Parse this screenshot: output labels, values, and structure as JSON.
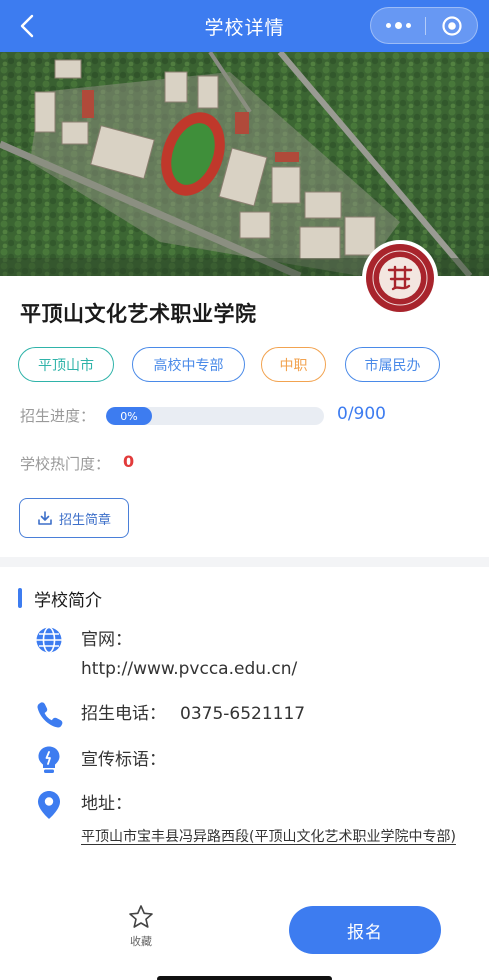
{
  "nav": {
    "title": "学校详情"
  },
  "school": {
    "name": "平顶山文化艺术职业学院",
    "tags": [
      "平顶山市",
      "高校中专部",
      "中职",
      "市属民办"
    ]
  },
  "progress": {
    "label": "招生进度：",
    "percent_text": "0%",
    "percent": 0,
    "total_text": "0/900"
  },
  "heat": {
    "label": "学校热门度：",
    "value": "0"
  },
  "brochure_button": {
    "label": "招生简章"
  },
  "intro": {
    "title": "学校简介",
    "website_label": "官网：",
    "website_url": "http://www.pvcca.edu.cn/",
    "phone_label": "招生电话：",
    "phone": "0375-6521117",
    "slogan_label": "宣传标语：",
    "address_label": "地址：",
    "address": "平顶山市宝丰县冯异路西段(平顶山文化艺术职业学院中专部)"
  },
  "footer": {
    "favorite_label": "收藏",
    "signup_label": "报名"
  },
  "colors": {
    "primary": "#3d7cf0",
    "tag_teal": "#2fb3a9",
    "tag_blue": "#4a8ae8",
    "tag_orange": "#f2a350",
    "heat_red": "#e23b3b"
  },
  "icons": {
    "back": "chevron-left-icon",
    "more": "more-dots-icon",
    "close": "target-circle-icon",
    "download": "download-icon",
    "globe": "globe-icon",
    "phone": "phone-icon",
    "lightbulb": "lightbulb-icon",
    "location": "location-pin-icon",
    "star": "star-outline-icon"
  }
}
